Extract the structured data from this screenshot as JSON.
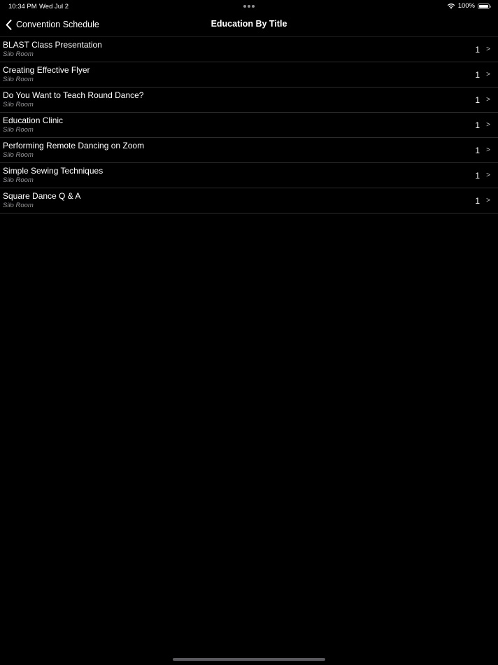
{
  "status_bar": {
    "time": "10:34 PM",
    "date": "Wed Jul 2",
    "battery_percent": "100%",
    "icons": [
      "wifi-icon",
      "battery-icon"
    ],
    "battery_level": 1.0
  },
  "nav": {
    "back_label": "Convention Schedule",
    "back_icon": "chevron-left-icon",
    "title": "Education By Title"
  },
  "colors": {
    "background": "#000000",
    "text": "#ffffff",
    "subtitle": "#98989d",
    "separator": "#2c2c2e"
  },
  "items": [
    {
      "title": "BLAST Class Presentation",
      "location": "Silo Room",
      "count": "1",
      "chevron": ">"
    },
    {
      "title": "Creating Effective Flyer",
      "location": "Silo Room",
      "count": "1",
      "chevron": ">"
    },
    {
      "title": "Do You Want to Teach Round Dance?",
      "location": "Silo Room",
      "count": "1",
      "chevron": ">"
    },
    {
      "title": "Education Clinic",
      "location": "Silo Room",
      "count": "1",
      "chevron": ">"
    },
    {
      "title": "Performing Remote Dancing on Zoom",
      "location": "Silo Room",
      "count": "1",
      "chevron": ">"
    },
    {
      "title": "Simple Sewing Techniques",
      "location": "Silo Room",
      "count": "1",
      "chevron": ">"
    },
    {
      "title": "Square Dance Q & A",
      "location": "Silo Room",
      "count": "1",
      "chevron": ">"
    }
  ]
}
